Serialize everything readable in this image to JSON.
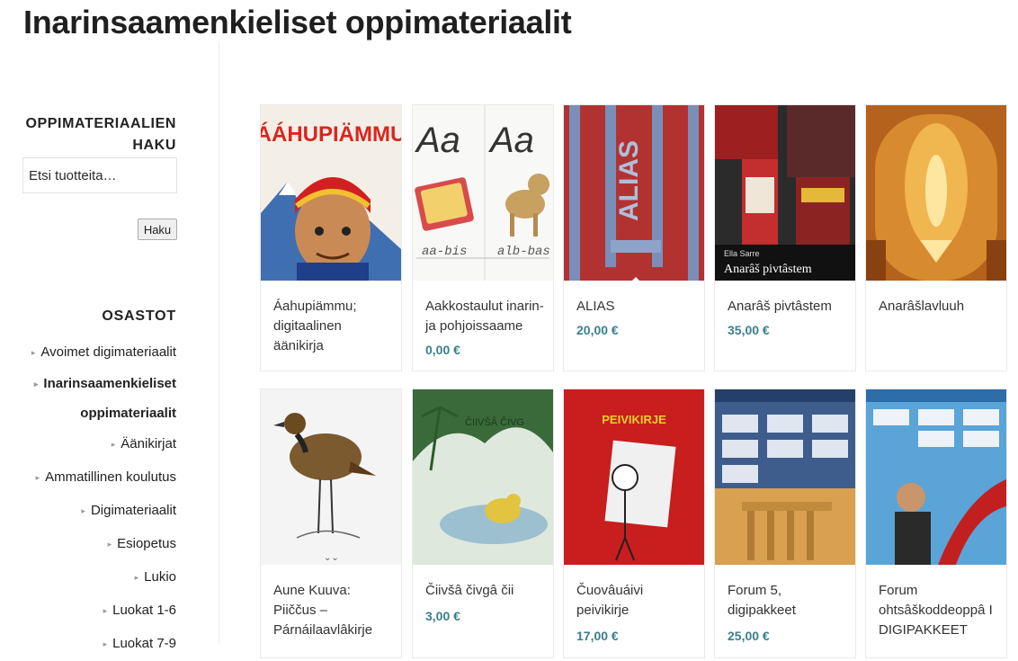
{
  "page": {
    "title": "Inarinsaamenkieliset oppimateriaalit"
  },
  "search": {
    "heading_line1": "OPPIMATERIAALIEN",
    "heading_line2": "HAKU",
    "placeholder": "Etsi tuotteita…",
    "button_label": "Haku"
  },
  "categories": {
    "heading": "OSASTOT",
    "items": [
      {
        "label": "Avoimet digimateriaalit"
      },
      {
        "label_line1": "Inarinsaamenkieliset",
        "label_line2": "oppimateriaalit"
      },
      {
        "label": "Äänikirjat"
      },
      {
        "label": "Ammatillinen koulutus"
      },
      {
        "label": "Digimateriaalit"
      },
      {
        "label": "Esiopetus"
      },
      {
        "label": "Lukio"
      },
      {
        "label": "Luokat 1-6"
      },
      {
        "label": "Luokat 7-9"
      }
    ]
  },
  "products": [
    {
      "title_line1": "Áahupiämmu;",
      "title_line2": "digitaalinen",
      "title_line3": "äänikirja",
      "price": "",
      "cover_text": "ÁÁHUPIÄMMU"
    },
    {
      "title_line1": "Aakkostaulut inarin-",
      "title_line2": "ja pohjoissaame",
      "price": "0,00 €",
      "cover_text_1": "Aa",
      "cover_text_2": "Aa",
      "cover_text_3": "aa-bis",
      "cover_text_4": "alb-bas"
    },
    {
      "title_line1": "ALIAS",
      "price": "20,00 €",
      "cover_text": "ALIAS"
    },
    {
      "title_line1": "Anarâš pivtâstem",
      "price": "35,00 €",
      "cover_author": "Ella Sarre",
      "cover_text": "Anarâš pivtâstem"
    },
    {
      "title_line1": "Anarâšlavluuh",
      "price": ""
    },
    {
      "title_line1": "Aune Kuuva:",
      "title_line2": "Piiččus –",
      "title_line3": "Párnáilaavlâkirje",
      "price": ""
    },
    {
      "title_line1": "Čiivšâ čivgâ čii",
      "price": "3,00 €",
      "cover_text": "ČIIVŠÂ ČIVG"
    },
    {
      "title_line1": "Čuovâuáivi",
      "title_line2": "peivikirje",
      "price": "17,00 €",
      "cover_text": "PEIVIKIRJE"
    },
    {
      "title_line1": "Forum 5,",
      "title_line2": "digipakkeet",
      "price": "25,00 €"
    },
    {
      "title_line1": "Forum",
      "title_line2": "ohtsâškoddeoppâ I",
      "title_line3": "DIGIPAKKEET",
      "price": ""
    }
  ]
}
